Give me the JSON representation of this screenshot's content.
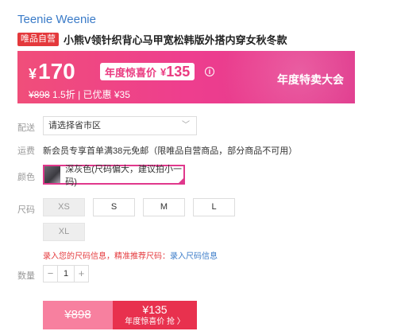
{
  "brand": "Teenie Weenie",
  "self_badge": "唯品自营",
  "title": "小熊V领针织背心马甲宽松韩版外搭内穿女秋冬款",
  "promo": {
    "yen": "¥",
    "price": "170",
    "deal_label": "年度惊喜价",
    "deal_yen": "¥",
    "deal_price": "135",
    "info_icon": "ⓘ",
    "original_price": "¥898",
    "discount_text": "1.5折 | 已优惠 ¥35",
    "event_name": "年度特卖大会",
    "colors": {
      "gradient_start": "#f04e7a",
      "gradient_end": "#e0388c"
    }
  },
  "region": {
    "label": "配送",
    "placeholder": "请选择省市区",
    "chevron": "﹀"
  },
  "freight": {
    "label": "运费",
    "text": "新会员专享首单满38元免邮（限唯品自营商品，部分商品不可用）"
  },
  "color": {
    "label": "颜色",
    "option": "深灰色(尺码偏大，建议拍小一码)"
  },
  "size": {
    "label": "尺码",
    "options": [
      "XS",
      "S",
      "M",
      "L",
      "XL"
    ],
    "hint": "录入您的尺码信息，精准推荐尺码：",
    "hint_link": "录入尺码信息"
  },
  "quantity": {
    "label": "数量",
    "minus": "−",
    "value": "1",
    "plus": "+"
  },
  "buy": {
    "original": "¥898",
    "price": "¥135",
    "action": "年度惊喜价 抢 〉",
    "colors": {
      "left": "#f7809f",
      "right": "#e8314e"
    }
  }
}
